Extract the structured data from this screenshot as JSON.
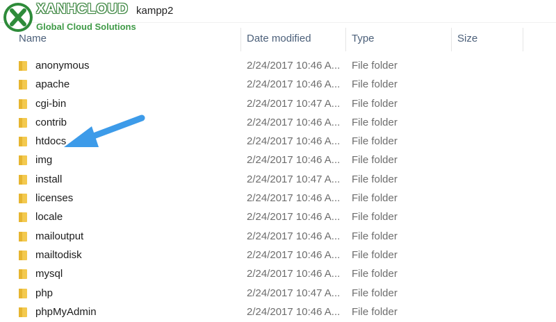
{
  "address_bar": {
    "path_text": "kampp2"
  },
  "watermark": {
    "title": "XANHCLOUD",
    "subtitle": "Global Cloud Solutions",
    "brand_color": "#3f9a47"
  },
  "columns": {
    "name": "Name",
    "date_modified": "Date modified",
    "type": "Type",
    "size": "Size"
  },
  "files": [
    {
      "name": "anonymous",
      "date": "2/24/2017 10:46 A...",
      "type": "File folder"
    },
    {
      "name": "apache",
      "date": "2/24/2017 10:46 A...",
      "type": "File folder"
    },
    {
      "name": "cgi-bin",
      "date": "2/24/2017 10:47 A...",
      "type": "File folder"
    },
    {
      "name": "contrib",
      "date": "2/24/2017 10:46 A...",
      "type": "File folder"
    },
    {
      "name": "htdocs",
      "date": "2/24/2017 10:46 A...",
      "type": "File folder"
    },
    {
      "name": "img",
      "date": "2/24/2017 10:46 A...",
      "type": "File folder"
    },
    {
      "name": "install",
      "date": "2/24/2017 10:47 A...",
      "type": "File folder"
    },
    {
      "name": "licenses",
      "date": "2/24/2017 10:46 A...",
      "type": "File folder"
    },
    {
      "name": "locale",
      "date": "2/24/2017 10:46 A...",
      "type": "File folder"
    },
    {
      "name": "mailoutput",
      "date": "2/24/2017 10:46 A...",
      "type": "File folder"
    },
    {
      "name": "mailtodisk",
      "date": "2/24/2017 10:46 A...",
      "type": "File folder"
    },
    {
      "name": "mysql",
      "date": "2/24/2017 10:46 A...",
      "type": "File folder"
    },
    {
      "name": "php",
      "date": "2/24/2017 10:47 A...",
      "type": "File folder"
    },
    {
      "name": "phpMyAdmin",
      "date": "2/24/2017 10:46 A...",
      "type": "File folder"
    }
  ],
  "icons": {
    "folder": "folder-icon",
    "annotation_arrow": "arrow-icon"
  },
  "colors": {
    "folder_yellow": "#f3c94f",
    "arrow_blue": "#3d9be9",
    "header_text": "#4c607a"
  }
}
